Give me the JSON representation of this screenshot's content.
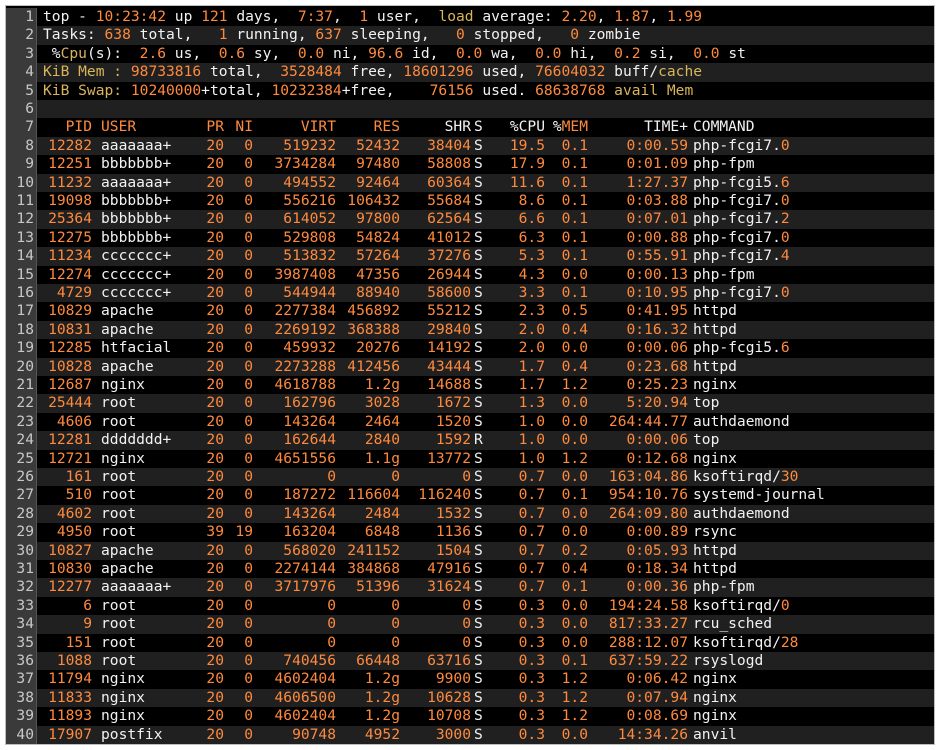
{
  "summary": [
    [
      [
        "top - ",
        "w"
      ],
      [
        "10:23:42",
        "o"
      ],
      [
        " up ",
        "w"
      ],
      [
        "121",
        "o"
      ],
      [
        " days,  ",
        "w"
      ],
      [
        "7:37",
        "o"
      ],
      [
        ",  ",
        "w"
      ],
      [
        "1",
        "o"
      ],
      [
        " user,  ",
        "w"
      ],
      [
        "load",
        "y"
      ],
      [
        " average: ",
        "w"
      ],
      [
        "2.20",
        "o"
      ],
      [
        ", ",
        "w"
      ],
      [
        "1.87",
        "o"
      ],
      [
        ", ",
        "w"
      ],
      [
        "1.99",
        "o"
      ]
    ],
    [
      [
        "Tasks: ",
        "w"
      ],
      [
        "638",
        "o"
      ],
      [
        " total,   ",
        "w"
      ],
      [
        "1",
        "o"
      ],
      [
        " running, ",
        "w"
      ],
      [
        "637",
        "o"
      ],
      [
        " sleeping,   ",
        "w"
      ],
      [
        "0",
        "o"
      ],
      [
        " stopped,   ",
        "w"
      ],
      [
        "0",
        "o"
      ],
      [
        " zombie",
        "w"
      ]
    ],
    [
      [
        " %",
        "w"
      ],
      [
        "Cpu",
        "y"
      ],
      [
        "(s):  ",
        "w"
      ],
      [
        "2.6",
        "o"
      ],
      [
        " us,  ",
        "w"
      ],
      [
        "0.6",
        "o"
      ],
      [
        " sy,  ",
        "w"
      ],
      [
        "0.0",
        "o"
      ],
      [
        " ni, ",
        "w"
      ],
      [
        "96.6",
        "o"
      ],
      [
        " id,  ",
        "w"
      ],
      [
        "0.0",
        "o"
      ],
      [
        " wa,  ",
        "w"
      ],
      [
        "0.0",
        "o"
      ],
      [
        " hi,  ",
        "w"
      ],
      [
        "0.2",
        "o"
      ],
      [
        " si,  ",
        "w"
      ],
      [
        "0.0",
        "o"
      ],
      [
        " st",
        "w"
      ]
    ],
    [
      [
        "KiB Mem : ",
        "y"
      ],
      [
        "98733816",
        "o"
      ],
      [
        " total,  ",
        "w"
      ],
      [
        "3528484",
        "o"
      ],
      [
        " free, ",
        "w"
      ],
      [
        "18601296",
        "o"
      ],
      [
        " used, ",
        "w"
      ],
      [
        "76604032",
        "o"
      ],
      [
        " buff/",
        "w"
      ],
      [
        "cache",
        "y"
      ]
    ],
    [
      [
        "KiB Swap: ",
        "y"
      ],
      [
        "10240000",
        "o"
      ],
      [
        "+total, ",
        "w"
      ],
      [
        "10232384",
        "o"
      ],
      [
        "+free,    ",
        "w"
      ],
      [
        "76156",
        "o"
      ],
      [
        " used. ",
        "w"
      ],
      [
        "68638768",
        "o"
      ],
      [
        " avail Mem",
        "y"
      ]
    ],
    []
  ],
  "columns": [
    {
      "key": "pid",
      "label": "PID"
    },
    {
      "key": "user",
      "label": "USER"
    },
    {
      "key": "pr",
      "label": "PR"
    },
    {
      "key": "ni",
      "label": "NI"
    },
    {
      "key": "virt",
      "label": "VIRT"
    },
    {
      "key": "res",
      "label": "RES"
    },
    {
      "key": "shr",
      "label": "SHR"
    },
    {
      "key": "s",
      "label": "S"
    },
    {
      "key": "cpu",
      "label": "%CPU"
    },
    {
      "key": "mem",
      "label": "%MEM"
    },
    {
      "key": "time",
      "label": "TIME+"
    },
    {
      "key": "cmd",
      "label": "COMMAND"
    }
  ],
  "header_mem_prefix": "%",
  "header_mem_suffix": "MEM",
  "processes": [
    [
      "12282",
      "aaaaaaa+",
      "20",
      "0",
      "519232",
      "52432",
      "38404",
      "S",
      "19.5",
      "0.1",
      "0:00.59",
      [
        "php-fcgi7.",
        "0"
      ]
    ],
    [
      "12251",
      "bbbbbbb+",
      "20",
      "0",
      "3734284",
      "97480",
      "58808",
      "S",
      "17.9",
      "0.1",
      "0:01.09",
      [
        "php-fpm",
        ""
      ]
    ],
    [
      "11232",
      "aaaaaaa+",
      "20",
      "0",
      "494552",
      "92464",
      "60364",
      "S",
      "11.6",
      "0.1",
      "1:27.37",
      [
        "php-fcgi5.",
        "6"
      ]
    ],
    [
      "19098",
      "bbbbbbb+",
      "20",
      "0",
      "556216",
      "106432",
      "55684",
      "S",
      "8.6",
      "0.1",
      "0:03.88",
      [
        "php-fcgi7.",
        "0"
      ]
    ],
    [
      "25364",
      "bbbbbbb+",
      "20",
      "0",
      "614052",
      "97800",
      "62564",
      "S",
      "6.6",
      "0.1",
      "0:07.01",
      [
        "php-fcgi7.",
        "2"
      ]
    ],
    [
      "12275",
      "bbbbbbb+",
      "20",
      "0",
      "529808",
      "54824",
      "41012",
      "S",
      "6.3",
      "0.1",
      "0:00.88",
      [
        "php-fcgi7.",
        "0"
      ]
    ],
    [
      "11234",
      "ccccccc+",
      "20",
      "0",
      "513832",
      "57264",
      "37276",
      "S",
      "5.3",
      "0.1",
      "0:55.91",
      [
        "php-fcgi7.",
        "4"
      ]
    ],
    [
      "12274",
      "ccccccc+",
      "20",
      "0",
      "3987408",
      "47356",
      "26944",
      "S",
      "4.3",
      "0.0",
      "0:00.13",
      [
        "php-fpm",
        ""
      ]
    ],
    [
      "4729",
      "ccccccc+",
      "20",
      "0",
      "544944",
      "88940",
      "58600",
      "S",
      "3.3",
      "0.1",
      "0:10.95",
      [
        "php-fcgi7.",
        "0"
      ]
    ],
    [
      "10829",
      "apache",
      "20",
      "0",
      "2277384",
      "456892",
      "55212",
      "S",
      "2.3",
      "0.5",
      "0:41.95",
      [
        "httpd",
        ""
      ]
    ],
    [
      "10831",
      "apache",
      "20",
      "0",
      "2269192",
      "368388",
      "29840",
      "S",
      "2.0",
      "0.4",
      "0:16.32",
      [
        "httpd",
        ""
      ]
    ],
    [
      "12285",
      "htfacial",
      "20",
      "0",
      "459932",
      "20276",
      "14192",
      "S",
      "2.0",
      "0.0",
      "0:00.06",
      [
        "php-fcgi5.",
        "6"
      ]
    ],
    [
      "10828",
      "apache",
      "20",
      "0",
      "2273288",
      "412456",
      "43444",
      "S",
      "1.7",
      "0.4",
      "0:23.68",
      [
        "httpd",
        ""
      ]
    ],
    [
      "12687",
      "nginx",
      "20",
      "0",
      "4618788",
      "1.2g",
      "14688",
      "S",
      "1.7",
      "1.2",
      "0:25.23",
      [
        "nginx",
        ""
      ]
    ],
    [
      "25444",
      "root",
      "20",
      "0",
      "162796",
      "3028",
      "1672",
      "S",
      "1.3",
      "0.0",
      "5:20.94",
      [
        "top",
        ""
      ]
    ],
    [
      "4606",
      "root",
      "20",
      "0",
      "143264",
      "2464",
      "1520",
      "S",
      "1.0",
      "0.0",
      "264:44.77",
      [
        "authdaemond",
        ""
      ]
    ],
    [
      "12281",
      "ddddddd+",
      "20",
      "0",
      "162644",
      "2840",
      "1592",
      "R",
      "1.0",
      "0.0",
      "0:00.06",
      [
        "top",
        ""
      ]
    ],
    [
      "12721",
      "nginx",
      "20",
      "0",
      "4651556",
      "1.1g",
      "13772",
      "S",
      "1.0",
      "1.2",
      "0:12.68",
      [
        "nginx",
        ""
      ]
    ],
    [
      "161",
      "root",
      "20",
      "0",
      "0",
      "0",
      "0",
      "S",
      "0.7",
      "0.0",
      "163:04.86",
      [
        "ksoftirqd/",
        "30"
      ]
    ],
    [
      "510",
      "root",
      "20",
      "0",
      "187272",
      "116604",
      "116240",
      "S",
      "0.7",
      "0.1",
      "954:10.76",
      [
        "systemd-journal",
        ""
      ]
    ],
    [
      "4602",
      "root",
      "20",
      "0",
      "143264",
      "2484",
      "1532",
      "S",
      "0.7",
      "0.0",
      "264:09.80",
      [
        "authdaemond",
        ""
      ]
    ],
    [
      "4950",
      "root",
      "39",
      "19",
      "163204",
      "6848",
      "1136",
      "S",
      "0.7",
      "0.0",
      "0:00.89",
      [
        "rsync",
        ""
      ]
    ],
    [
      "10827",
      "apache",
      "20",
      "0",
      "568020",
      "241152",
      "1504",
      "S",
      "0.7",
      "0.2",
      "0:05.93",
      [
        "httpd",
        ""
      ]
    ],
    [
      "10830",
      "apache",
      "20",
      "0",
      "2274144",
      "384868",
      "47916",
      "S",
      "0.7",
      "0.4",
      "0:18.34",
      [
        "httpd",
        ""
      ]
    ],
    [
      "12277",
      "aaaaaaa+",
      "20",
      "0",
      "3717976",
      "51396",
      "31624",
      "S",
      "0.7",
      "0.1",
      "0:00.36",
      [
        "php-fpm",
        ""
      ]
    ],
    [
      "6",
      "root",
      "20",
      "0",
      "0",
      "0",
      "0",
      "S",
      "0.3",
      "0.0",
      "194:24.58",
      [
        "ksoftirqd/",
        "0"
      ]
    ],
    [
      "9",
      "root",
      "20",
      "0",
      "0",
      "0",
      "0",
      "S",
      "0.3",
      "0.0",
      "817:33.27",
      [
        "rcu_sched",
        ""
      ]
    ],
    [
      "151",
      "root",
      "20",
      "0",
      "0",
      "0",
      "0",
      "S",
      "0.3",
      "0.0",
      "288:12.07",
      [
        "ksoftirqd/",
        "28"
      ]
    ],
    [
      "1088",
      "root",
      "20",
      "0",
      "740456",
      "66448",
      "63716",
      "S",
      "0.3",
      "0.1",
      "637:59.22",
      [
        "rsyslogd",
        ""
      ]
    ],
    [
      "11794",
      "nginx",
      "20",
      "0",
      "4602404",
      "1.2g",
      "9900",
      "S",
      "0.3",
      "1.2",
      "0:06.42",
      [
        "nginx",
        ""
      ]
    ],
    [
      "11833",
      "nginx",
      "20",
      "0",
      "4606500",
      "1.2g",
      "10628",
      "S",
      "0.3",
      "1.2",
      "0:07.94",
      [
        "nginx",
        ""
      ]
    ],
    [
      "11893",
      "nginx",
      "20",
      "0",
      "4602404",
      "1.2g",
      "10708",
      "S",
      "0.3",
      "1.2",
      "0:08.69",
      [
        "nginx",
        ""
      ]
    ],
    [
      "17907",
      "postfix",
      "20",
      "0",
      "90748",
      "4952",
      "3000",
      "S",
      "0.3",
      "0.0",
      "14:34.26",
      [
        "anvil",
        ""
      ]
    ]
  ]
}
